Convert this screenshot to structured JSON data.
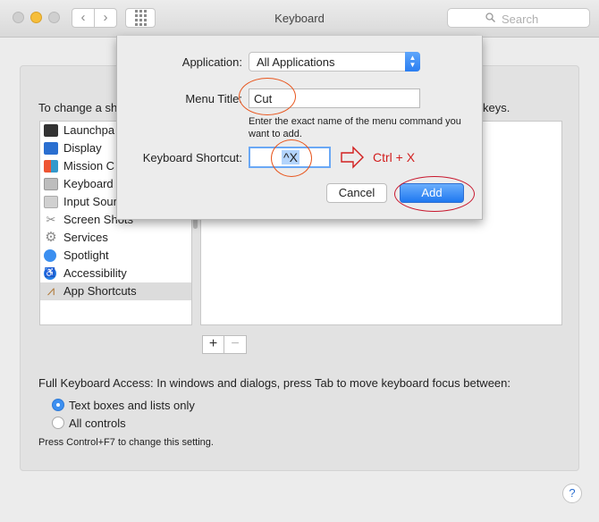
{
  "window": {
    "title": "Keyboard",
    "search_placeholder": "Search",
    "nav_back": "‹",
    "nav_forward": "›",
    "help": "?"
  },
  "main": {
    "intro_left": "To change a sh",
    "intro_right": "keys.",
    "categories": [
      {
        "label": "Launchpa",
        "icon": "launchpad-icon"
      },
      {
        "label": "Display",
        "icon": "display-icon"
      },
      {
        "label": "Mission C",
        "icon": "mission-control-icon"
      },
      {
        "label": "Keyboard",
        "icon": "keyboard-icon"
      },
      {
        "label": "Input Sour",
        "icon": "input-sources-icon"
      },
      {
        "label": "Screen Shots",
        "icon": "screenshot-icon"
      },
      {
        "label": "Services",
        "icon": "gear-icon"
      },
      {
        "label": "Spotlight",
        "icon": "spotlight-icon"
      },
      {
        "label": "Accessibility",
        "icon": "accessibility-icon"
      },
      {
        "label": "App Shortcuts",
        "icon": "app-shortcuts-icon",
        "selected": true
      }
    ],
    "add_button": "+",
    "remove_button": "−",
    "full_keyboard_access": "Full Keyboard Access: In windows and dialogs, press Tab to move keyboard focus between:",
    "radio_options": [
      {
        "label": "Text boxes and lists only",
        "checked": true
      },
      {
        "label": "All controls",
        "checked": false
      }
    ],
    "hint": "Press Control+F7 to change this setting."
  },
  "dialog": {
    "application_label": "Application:",
    "application_value": "All Applications",
    "menu_title_label": "Menu Title:",
    "menu_title_value": "Cut",
    "description": "Enter the exact name of the menu command you want to add.",
    "shortcut_label": "Keyboard Shortcut:",
    "shortcut_value": "^X",
    "annotation_text": "Ctrl + X",
    "cancel_label": "Cancel",
    "add_label": "Add"
  },
  "colors": {
    "accent": "#2a7ef1",
    "annotation_orange": "#e8561e",
    "annotation_red": "#c8172d"
  }
}
